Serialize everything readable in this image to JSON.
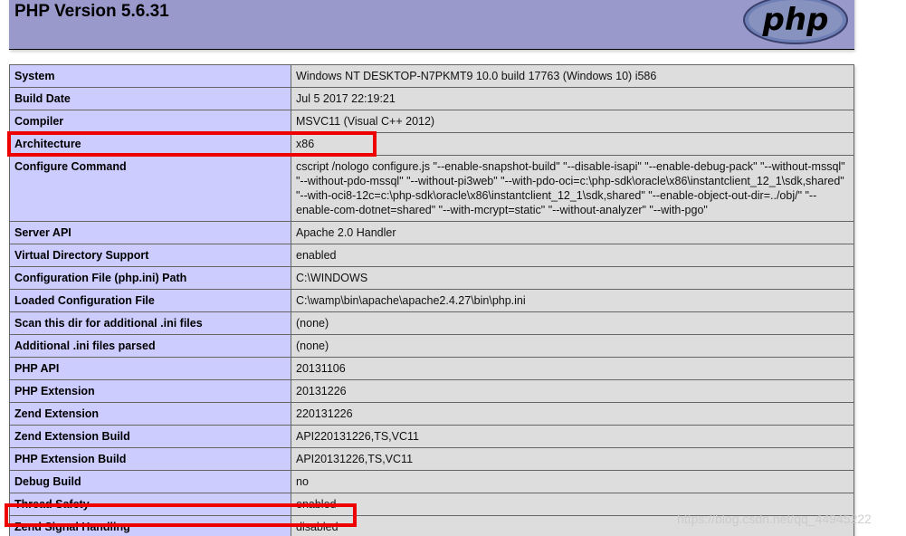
{
  "header": {
    "title": "PHP Version 5.6.31",
    "logo_text": "php"
  },
  "rows": [
    {
      "key": "System",
      "value": "Windows NT DESKTOP-N7PKMT9 10.0 build 17763 (Windows 10) i586"
    },
    {
      "key": "Build Date",
      "value": "Jul 5 2017 22:19:21"
    },
    {
      "key": "Compiler",
      "value": "MSVC11 (Visual C++ 2012)"
    },
    {
      "key": "Architecture",
      "value": "x86"
    },
    {
      "key": "Configure Command",
      "value": "cscript /nologo configure.js \"--enable-snapshot-build\" \"--disable-isapi\" \"--enable-debug-pack\" \"--without-mssql\" \"--without-pdo-mssql\" \"--without-pi3web\" \"--with-pdo-oci=c:\\php-sdk\\oracle\\x86\\instantclient_12_1\\sdk,shared\" \"--with-oci8-12c=c:\\php-sdk\\oracle\\x86\\instantclient_12_1\\sdk,shared\" \"--enable-object-out-dir=../obj/\" \"--enable-com-dotnet=shared\" \"--with-mcrypt=static\" \"--without-analyzer\" \"--with-pgo\""
    },
    {
      "key": "Server API",
      "value": "Apache 2.0 Handler"
    },
    {
      "key": "Virtual Directory Support",
      "value": "enabled"
    },
    {
      "key": "Configuration File (php.ini) Path",
      "value": "C:\\WINDOWS"
    },
    {
      "key": "Loaded Configuration File",
      "value": "C:\\wamp\\bin\\apache\\apache2.4.27\\bin\\php.ini"
    },
    {
      "key": "Scan this dir for additional .ini files",
      "value": "(none)"
    },
    {
      "key": "Additional .ini files parsed",
      "value": "(none)"
    },
    {
      "key": "PHP API",
      "value": "20131106"
    },
    {
      "key": "PHP Extension",
      "value": "20131226"
    },
    {
      "key": "Zend Extension",
      "value": "220131226"
    },
    {
      "key": "Zend Extension Build",
      "value": "API220131226,TS,VC11"
    },
    {
      "key": "PHP Extension Build",
      "value": "API20131226,TS,VC11"
    },
    {
      "key": "Debug Build",
      "value": "no"
    },
    {
      "key": "Thread Safety",
      "value": "enabled"
    },
    {
      "key": "Zend Signal Handling",
      "value": "disabled"
    }
  ],
  "watermark": "https://blog.csdn.net/qq_44945222",
  "colors": {
    "header_bg": "#9999cc",
    "key_bg": "#ccccff",
    "value_bg": "#dddddd",
    "highlight": "#ee0000"
  }
}
